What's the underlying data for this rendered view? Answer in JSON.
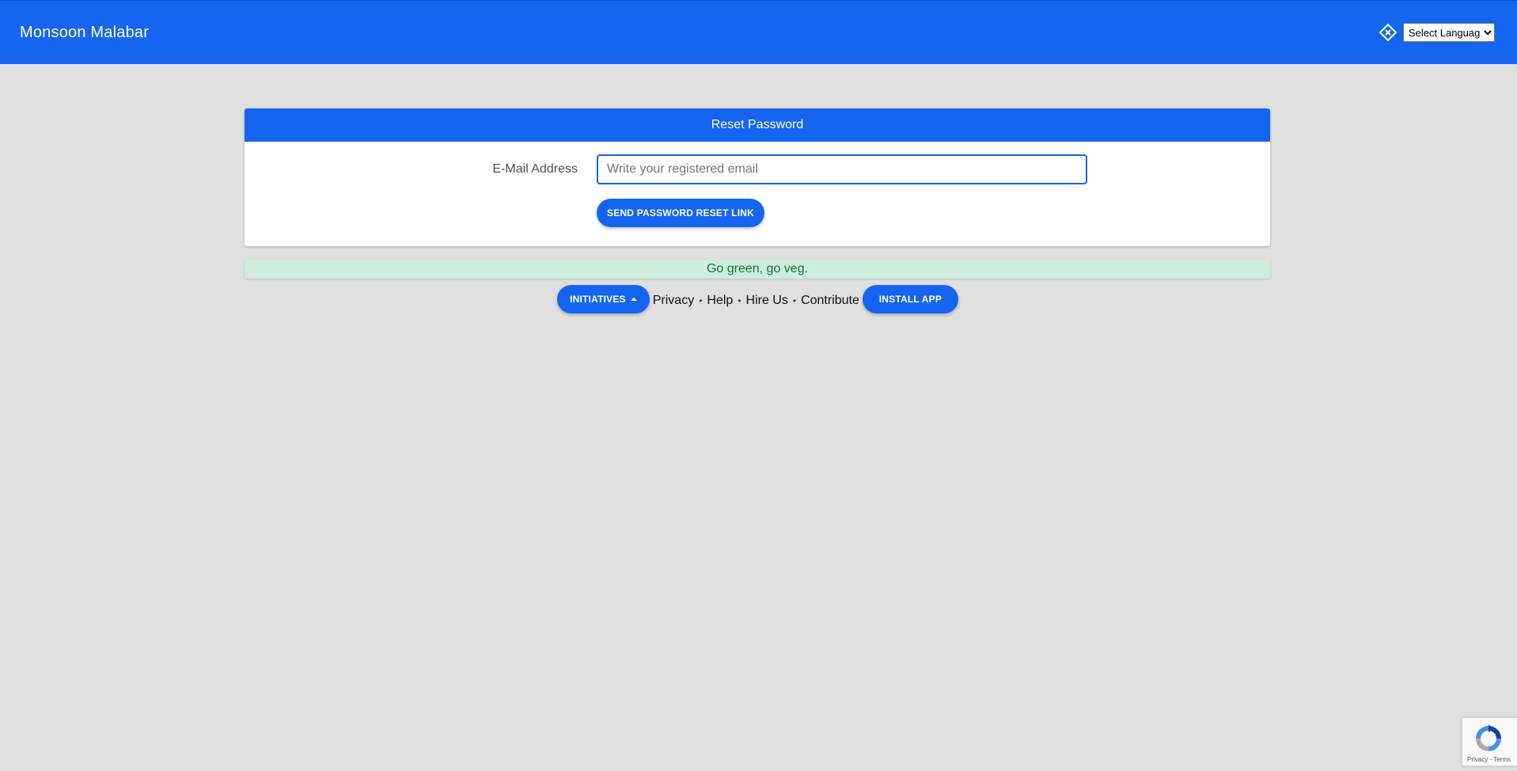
{
  "navbar": {
    "brand": "Monsoon Malabar",
    "language_select": {
      "selected": "Select Language"
    }
  },
  "card": {
    "title": "Reset Password",
    "email_label": "E-Mail Address",
    "email_placeholder": "Write your registered email",
    "email_value": "",
    "submit_label": "Send Password Reset Link"
  },
  "alert": {
    "message": "Go green, go veg."
  },
  "footer": {
    "initiatives_label": "Initiatives",
    "links": [
      "Privacy",
      "Help",
      "Hire Us",
      "Contribute"
    ],
    "separator": "•",
    "install_label": "Install App"
  },
  "recaptcha": {
    "privacy": "Privacy",
    "separator": "-",
    "terms": "Terms"
  },
  "colors": {
    "primary": "#1565f0",
    "background": "#e0e0e0",
    "alert_bg": "#cdeedb",
    "alert_text": "#17703a"
  },
  "icons": {
    "translate": "google-translate-icon",
    "recaptcha": "recaptcha-icon"
  }
}
